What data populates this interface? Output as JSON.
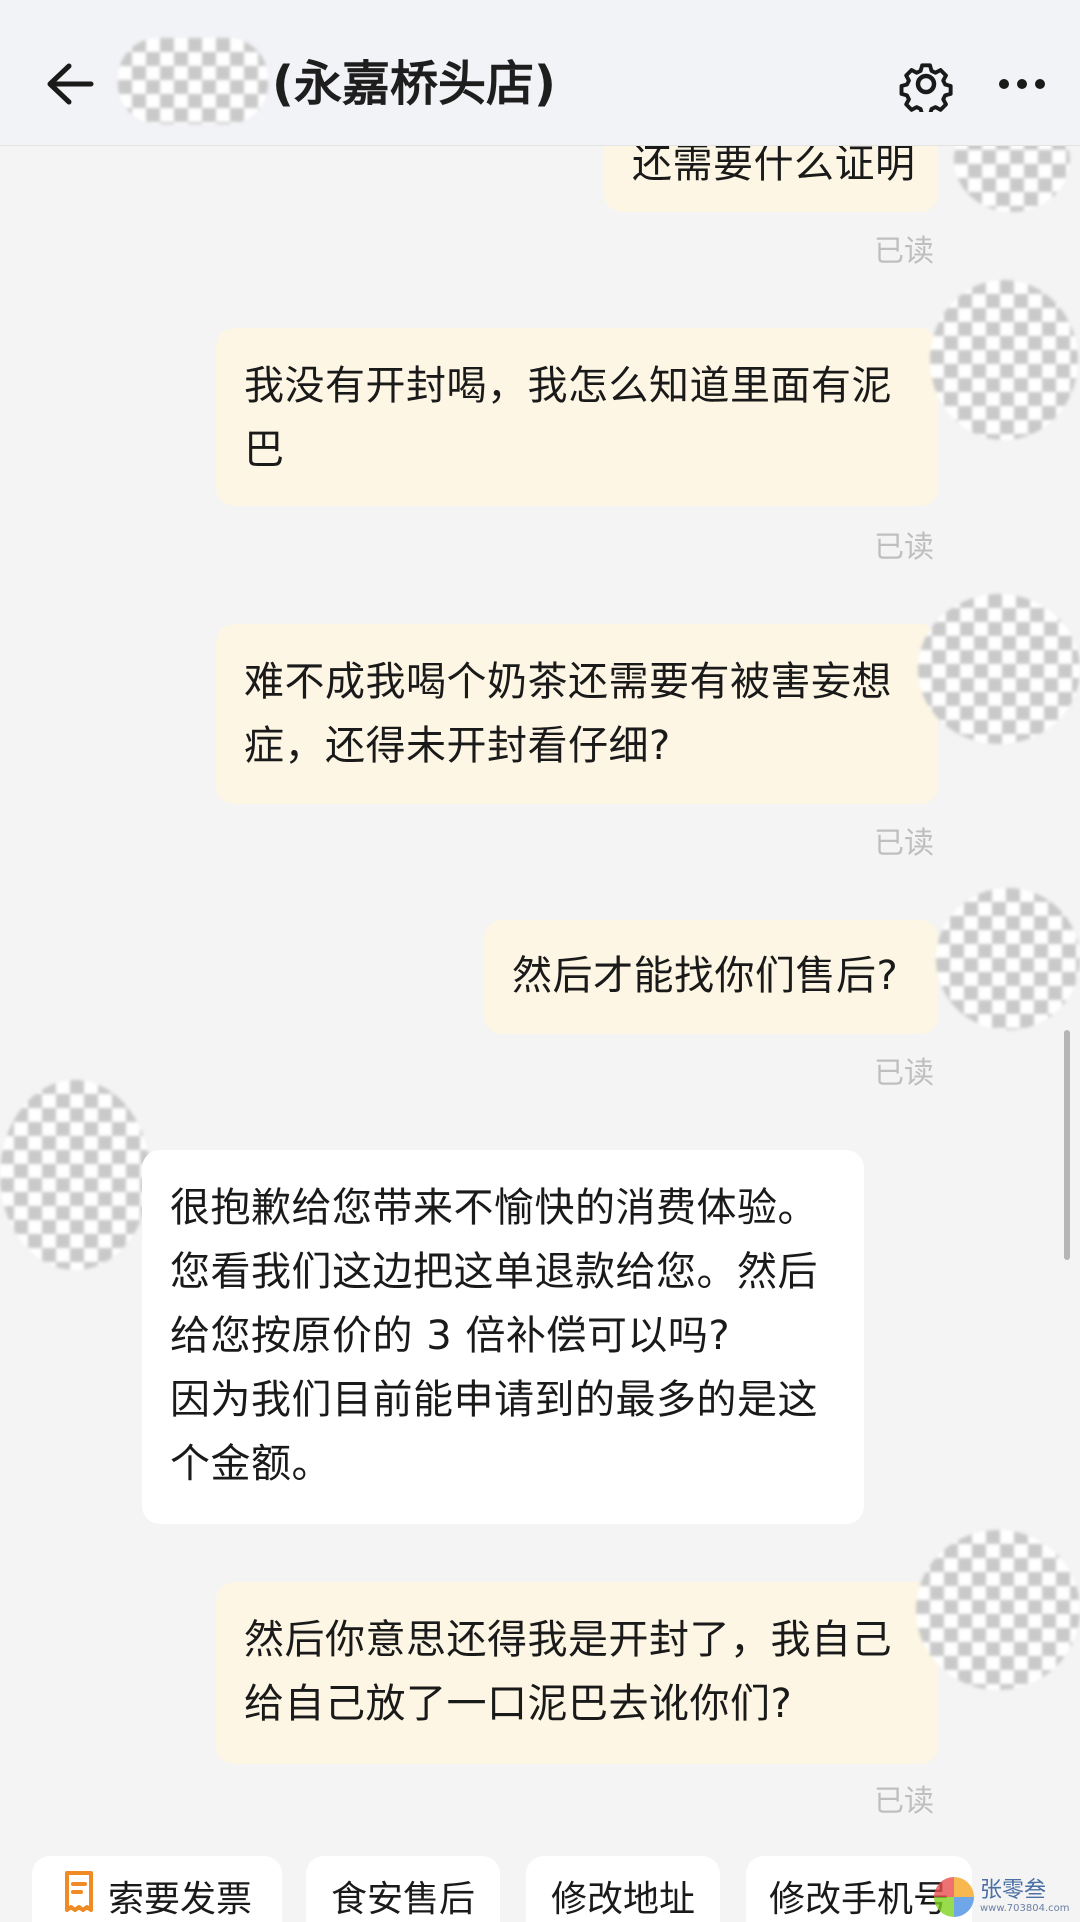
{
  "header": {
    "title": "(永嘉桥头店)"
  },
  "messages": [
    {
      "direction": "out",
      "lines": [
        "还需要什么证明"
      ],
      "status": "已读"
    },
    {
      "direction": "out",
      "lines": [
        "我没有开封喝，我怎么知道里面有泥",
        "巴"
      ],
      "status": "已读"
    },
    {
      "direction": "out",
      "lines": [
        "难不成我喝个奶茶还需要有被害妄想",
        "症，还得未开封看仔细?"
      ],
      "status": "已读"
    },
    {
      "direction": "out",
      "lines": [
        "然后才能找你们售后?"
      ],
      "status": "已读"
    },
    {
      "direction": "in",
      "lines": [
        "很抱歉给您带来不愉快的消费体验。",
        "您看我们这边把这单退款给您。然后",
        "给您按原价的 3 倍补偿可以吗?",
        "因为我们目前能申请到的最多的是这",
        "个金额。"
      ]
    },
    {
      "direction": "out",
      "lines": [
        "然后你意思还得我是开封了，我自己",
        "给自己放了一口泥巴去讹你们?"
      ],
      "status": "已读"
    }
  ],
  "quick_actions": [
    {
      "label": "索要发票",
      "icon": "receipt-icon"
    },
    {
      "label": "食安售后"
    },
    {
      "label": "修改地址"
    },
    {
      "label": "修改手机号"
    }
  ],
  "watermark": {
    "name": "张零叁",
    "url": "www.703804.com"
  },
  "colors": {
    "outgoing_bubble": "#fdf6e4",
    "incoming_bubble": "#ffffff",
    "background": "#f4f4f4",
    "read_status": "#bfbfbf",
    "receipt_icon": "#f08a24"
  }
}
